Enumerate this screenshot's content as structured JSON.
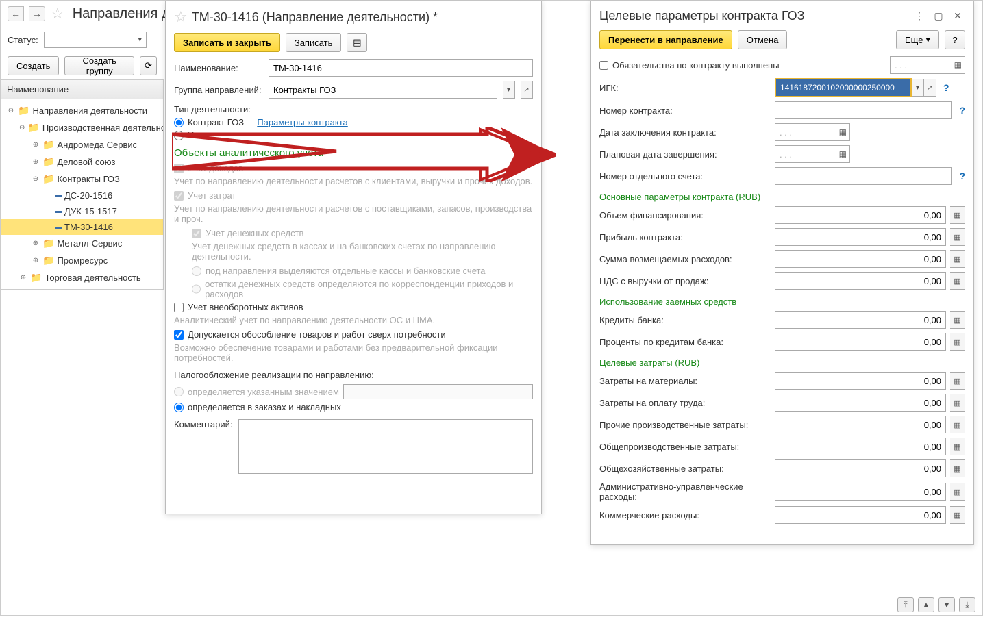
{
  "topbar": {
    "title": "Направления деятельности"
  },
  "toolbar": {
    "status_label": "Статус:",
    "create": "Создать",
    "create_group": "Создать группу"
  },
  "left": {
    "header": "Наименование",
    "tree": [
      {
        "label": "Направления деятельности",
        "lvl": 0,
        "exp": "⊖",
        "folder": true
      },
      {
        "label": "Производственная деятельность",
        "lvl": 1,
        "exp": "⊖",
        "folder": true
      },
      {
        "label": "Андромеда Сервис",
        "lvl": 2,
        "exp": "⊕",
        "folder": true
      },
      {
        "label": "Деловой союз",
        "lvl": 2,
        "exp": "⊕",
        "folder": true
      },
      {
        "label": "Контракты ГОЗ",
        "lvl": 2,
        "exp": "⊖",
        "folder": true
      },
      {
        "label": "ДС-20-1516",
        "lvl": 3,
        "exp": "",
        "folder": false
      },
      {
        "label": "ДУК-15-1517",
        "lvl": 3,
        "exp": "",
        "folder": false
      },
      {
        "label": "ТМ-30-1416",
        "lvl": 3,
        "exp": "",
        "folder": false,
        "sel": true
      },
      {
        "label": "Металл-Сервис",
        "lvl": 2,
        "exp": "⊕",
        "folder": true
      },
      {
        "label": "Промресурс",
        "lvl": 2,
        "exp": "⊕",
        "folder": true
      },
      {
        "label": "Торговая деятельность",
        "lvl": 1,
        "exp": "⊕",
        "folder": true
      }
    ]
  },
  "center": {
    "title": "ТМ-30-1416 (Направление деятельности) *",
    "save_close": "Записать и закрыть",
    "save": "Записать",
    "name_lbl": "Наименование:",
    "name_val": "ТМ-30-1416",
    "group_lbl": "Группа направлений:",
    "group_val": "Контракты ГОЗ",
    "type_lbl": "Тип деятельности:",
    "radio_goz": "Контракт ГОЗ",
    "params_link": "Параметры контракта",
    "radio_other": "Иная",
    "section_analytics": "Объекты аналитического учета",
    "chk_income": "Учет доходов",
    "income_desc": "Учет по направлению деятельности расчетов с клиентами, выручки и прочих доходов.",
    "chk_costs": "Учет затрат",
    "costs_desc": "Учет по направлению деятельности расчетов с поставщиками, запасов, производства и проч.",
    "chk_money": "Учет денежных средств",
    "money_desc": "Учет денежных средств в кассах и на банковских счетах по направлению деятельности.",
    "radio_money1": "под направления выделяются отдельные кассы и банковские счета",
    "radio_money2": "остатки денежных средств определяются по корреспонденции приходов и расходов",
    "chk_fixed": "Учет внеоборотных активов",
    "fixed_desc": "Аналитический учет по направлению деятельности ОС и НМА.",
    "chk_separation": "Допускается обособление товаров и работ сверх потребности",
    "separation_desc": "Возможно обеспечение товарами и работами без предварительной фиксации потребностей.",
    "tax_lbl": "Налогообложение реализации по направлению:",
    "radio_tax1": "определяется указанным значением",
    "radio_tax2": "определяется в заказах и накладных",
    "comment_lbl": "Комментарий:"
  },
  "right": {
    "title": "Целевые параметры контракта ГОЗ",
    "transfer": "Перенести в направление",
    "cancel": "Отмена",
    "more": "Еще",
    "help": "?",
    "obligations": "Обязательства по контракту выполнены",
    "igk_lbl": "ИГК:",
    "igk_val": "1416187200102000000250000",
    "num_lbl": "Номер контракта:",
    "date_lbl": "Дата заключения контракта:",
    "plan_date_lbl": "Плановая дата завершения:",
    "account_lbl": "Номер отдельного счета:",
    "sec_main": "Основные параметры контракта (RUB)",
    "finance_lbl": "Объем финансирования:",
    "profit_lbl": "Прибыль контракта:",
    "refund_lbl": "Сумма возмещаемых расходов:",
    "vat_lbl": "НДС с выручки от продаж:",
    "sec_loans": "Использование заемных средств",
    "credits_lbl": "Кредиты банка:",
    "interest_lbl": "Проценты по кредитам банка:",
    "sec_costs": "Целевые затраты (RUB)",
    "materials_lbl": "Затраты на материалы:",
    "labor_lbl": "Затраты на оплату труда:",
    "other_prod_lbl": "Прочие производственные затраты:",
    "overhead_lbl": "Общепроизводственные затраты:",
    "general_lbl": "Общехозяйственные затраты:",
    "admin_lbl": "Административно-управленческие расходы:",
    "commercial_lbl": "Коммерческие расходы:",
    "zero": "0,00",
    "date_placeholder": ".  .  ."
  }
}
